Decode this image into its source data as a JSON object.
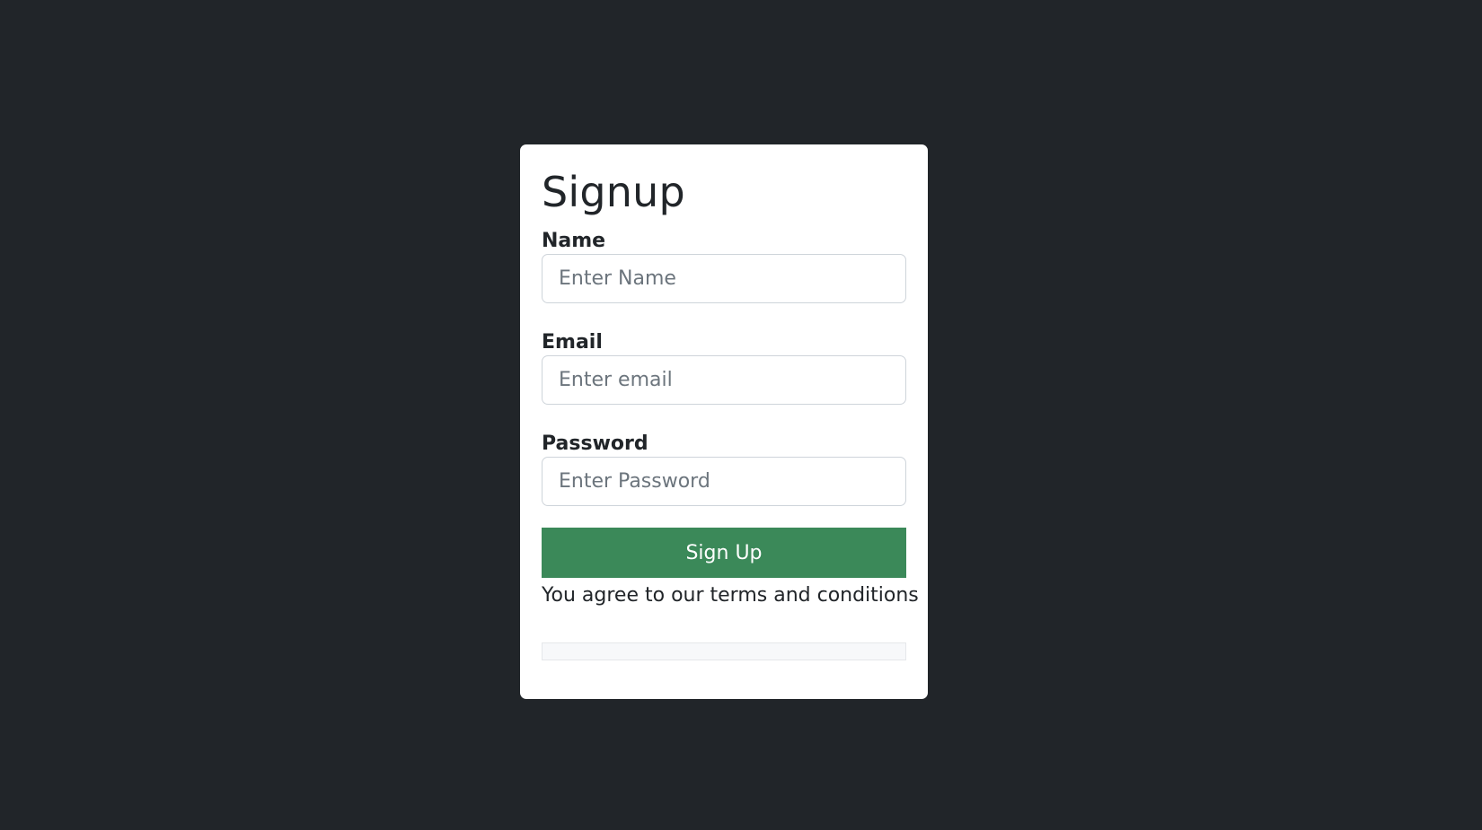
{
  "signup": {
    "title": "Signup",
    "fields": [
      {
        "label": "Name",
        "placeholder": "Enter Name",
        "value": ""
      },
      {
        "label": "Email",
        "placeholder": "Enter email",
        "value": ""
      },
      {
        "label": "Password",
        "placeholder": "Enter Password",
        "value": ""
      }
    ],
    "submit_label": "Sign Up",
    "terms_text": "You agree to our terms and conditions"
  },
  "colors": {
    "background": "#212529",
    "card": "#ffffff",
    "button": "#3b8959",
    "text": "#212529",
    "placeholder": "#6c757d"
  }
}
